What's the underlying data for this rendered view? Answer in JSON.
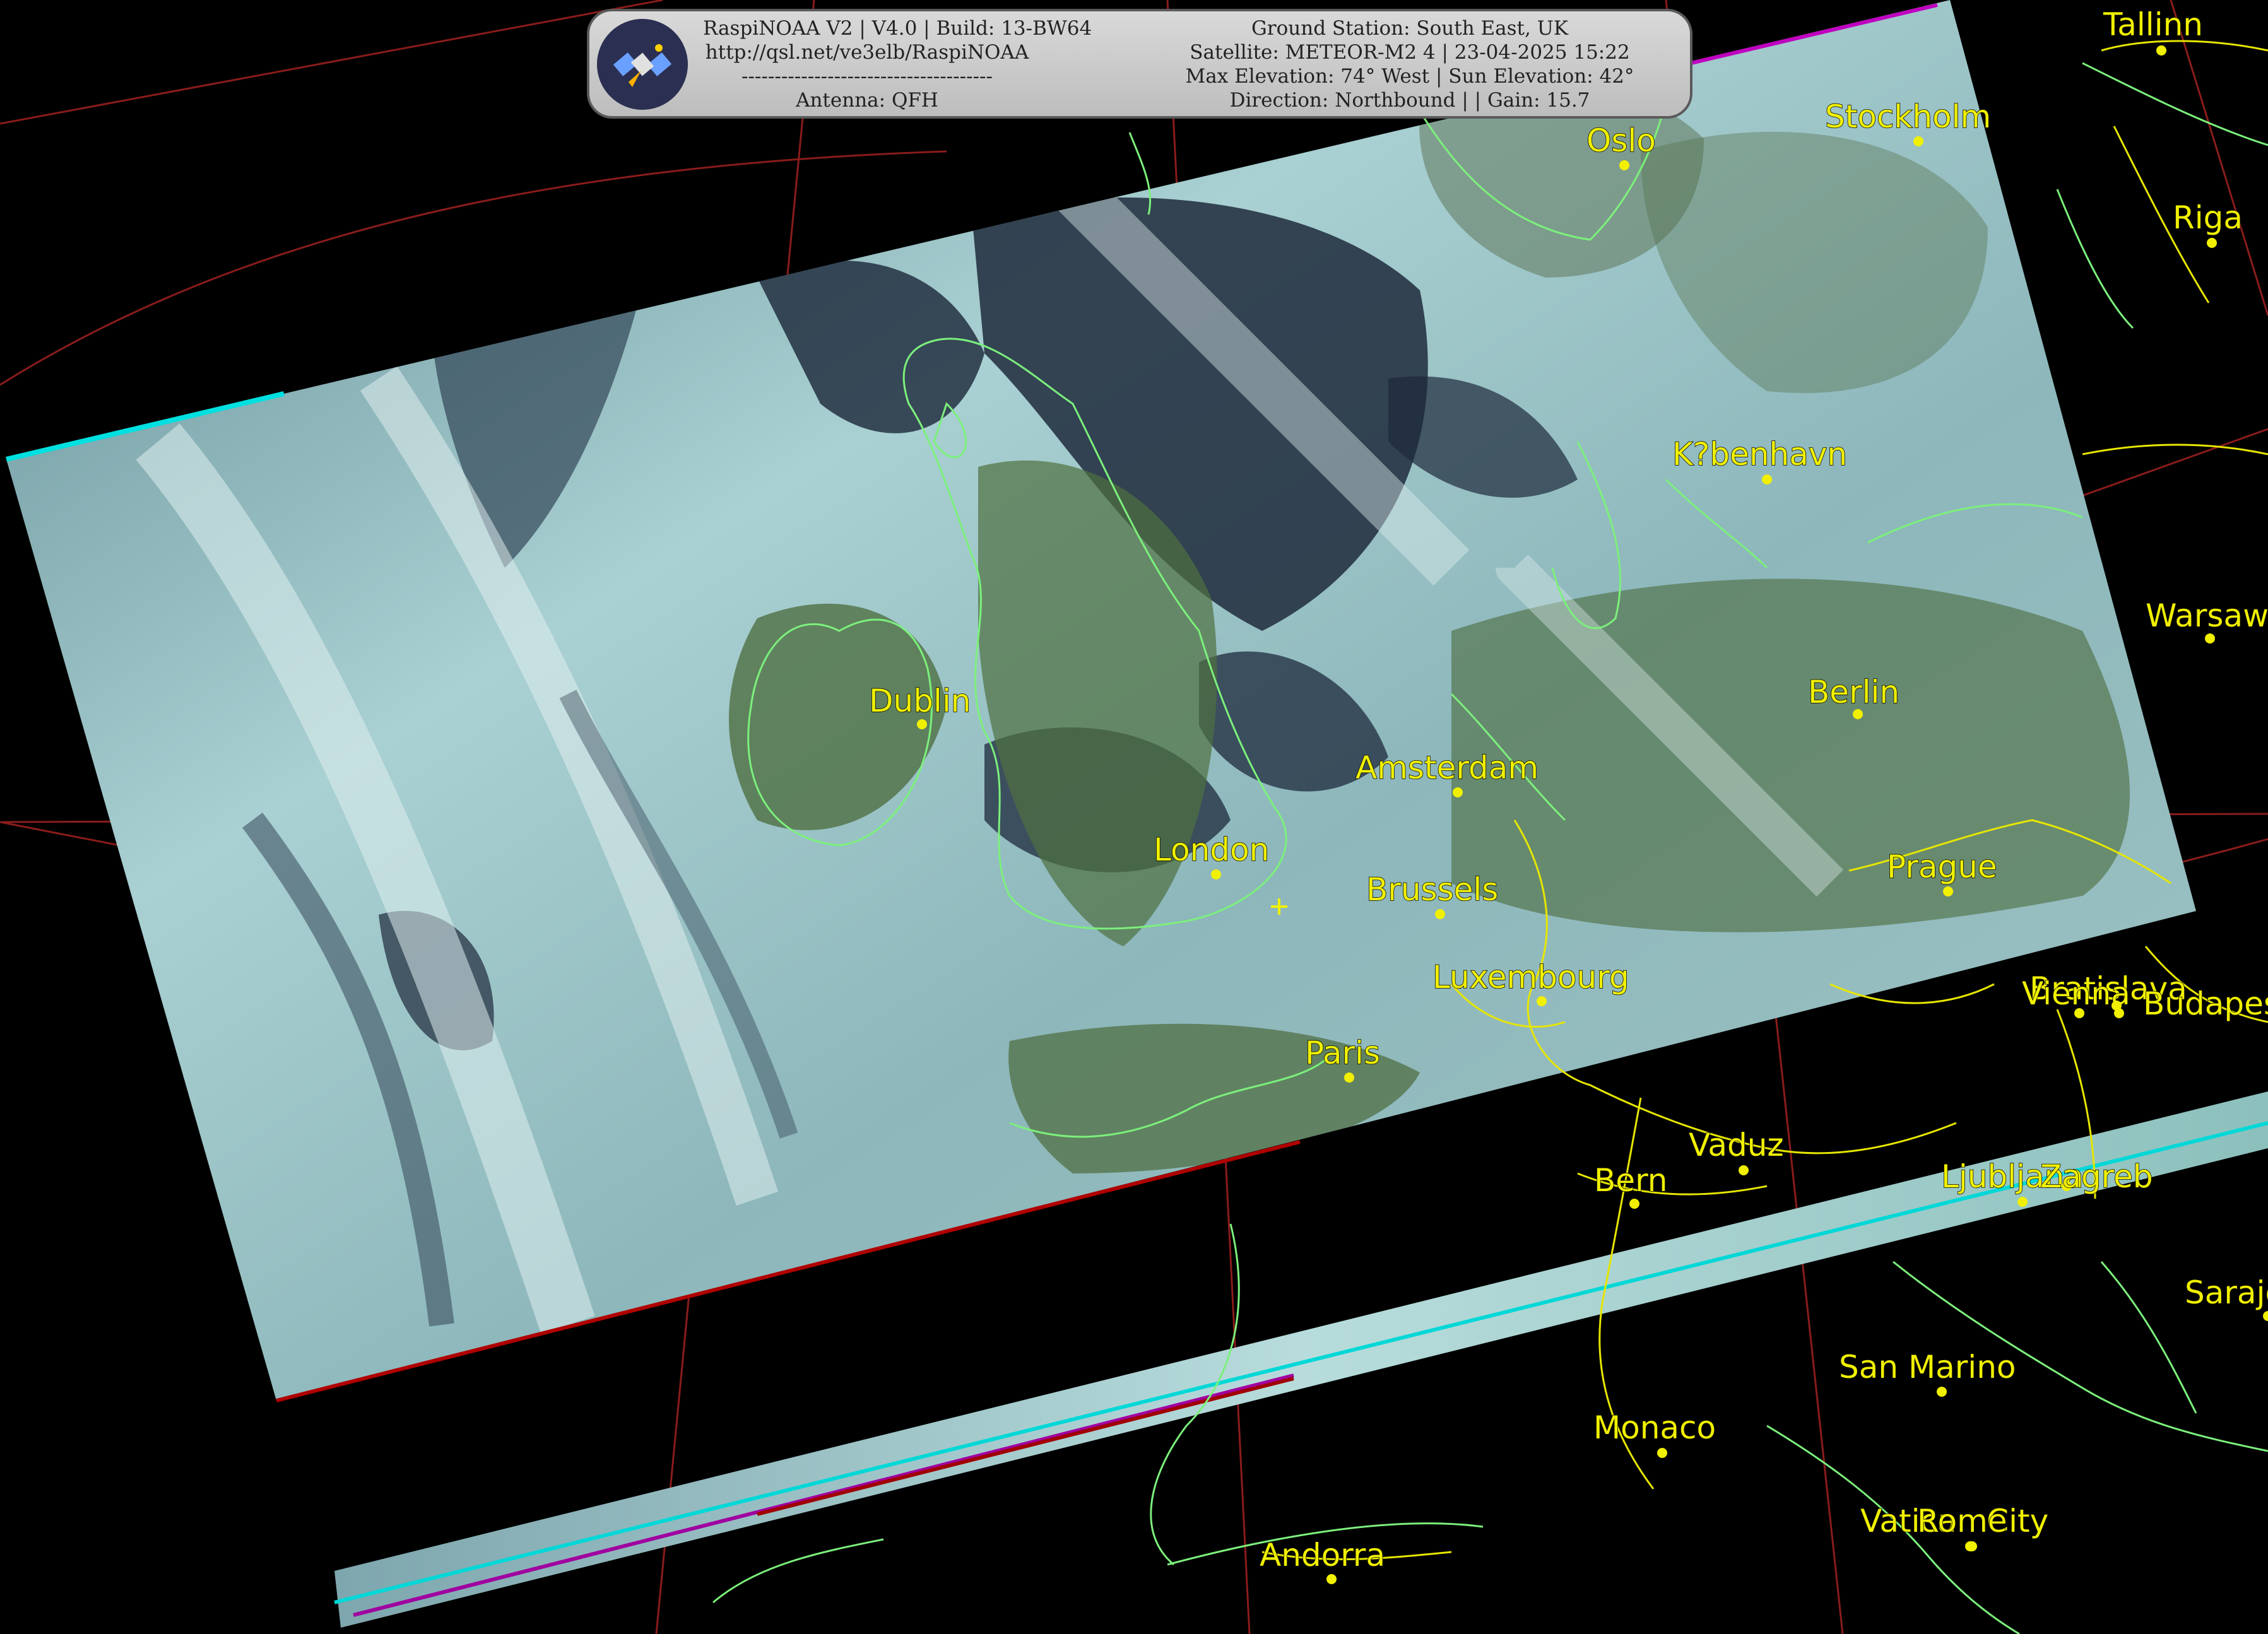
{
  "header": {
    "app_line": "RaspiNOAA V2 | V4.0 | Build: 13-BW64",
    "url": "http://qsl.net/ve3elb/RaspiNOAA",
    "divider": "--------------------------------------",
    "antenna": "Antenna: QFH",
    "ground_station": "Ground Station: South East, UK",
    "satellite": "Satellite: METEOR-M2 4 | 23-04-2025 15:22",
    "elevation": "Max Elevation: 74° West | Sun Elevation: 42°",
    "direction": "Direction: Northbound | | Gain: 15.7"
  },
  "logo_icon": "satellite-icon",
  "colors": {
    "background": "#000000",
    "coastline": "#7cf07c",
    "border": "#e6e600",
    "graticule": "#8a1c1c",
    "city_label": "#f0f000",
    "cloud": "#c8e6e6",
    "sea": "#1e2a3c",
    "land": "#4a6a3a"
  },
  "cities": [
    {
      "name": "Tallinn"
    },
    {
      "name": "Stockholm"
    },
    {
      "name": "Oslo"
    },
    {
      "name": "Riga"
    },
    {
      "name": "K?benhavn"
    },
    {
      "name": "Warsaw"
    },
    {
      "name": "Berlin"
    },
    {
      "name": "Dublin"
    },
    {
      "name": "Amsterdam"
    },
    {
      "name": "London"
    },
    {
      "name": "Brussels"
    },
    {
      "name": "Prague"
    },
    {
      "name": "Luxembourg"
    },
    {
      "name": "Bratislava"
    },
    {
      "name": "Vienna"
    },
    {
      "name": "Budapest"
    },
    {
      "name": "Paris"
    },
    {
      "name": "Vaduz"
    },
    {
      "name": "Bern"
    },
    {
      "name": "Ljubljana"
    },
    {
      "name": "Zagreb"
    },
    {
      "name": "Sarajevo"
    },
    {
      "name": "San Marino"
    },
    {
      "name": "Monaco"
    },
    {
      "name": "Vatican City"
    },
    {
      "name": "Rome"
    },
    {
      "name": "Andorra"
    }
  ]
}
